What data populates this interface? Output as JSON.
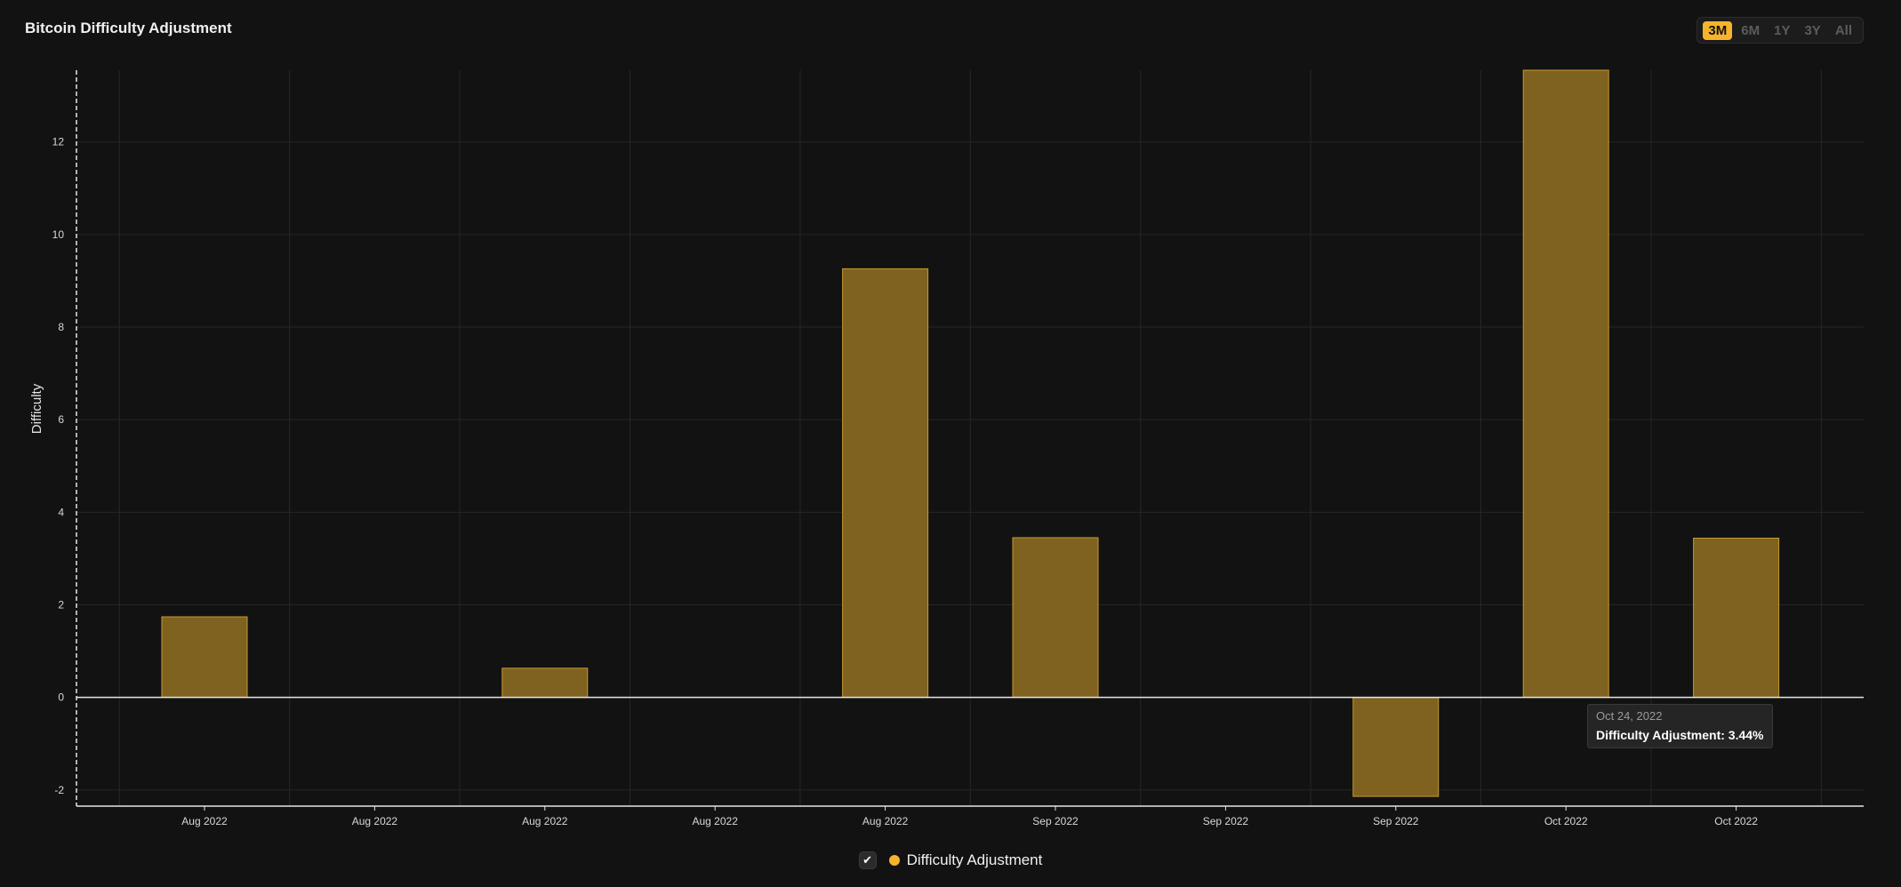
{
  "header": {
    "title": "Bitcoin Difficulty Adjustment"
  },
  "range_selector": {
    "options": [
      "3M",
      "6M",
      "1Y",
      "3Y",
      "All"
    ],
    "selected": "3M"
  },
  "legend": {
    "check_glyph": "✔",
    "label": "Difficulty Adjustment",
    "color": "#f7b32b"
  },
  "tooltip": {
    "date": "Oct 24, 2022",
    "text": "Difficulty Adjustment: 3.44%"
  },
  "chart_data": {
    "type": "bar",
    "ylabel": "Difficulty",
    "xlabel": "",
    "categories": [
      "Aug 2022",
      "Aug 2022",
      "Aug 2022",
      "Aug 2022",
      "Aug 2022",
      "Sep 2022",
      "Sep 2022",
      "Sep 2022",
      "Oct 2022",
      "Oct 2022"
    ],
    "series": [
      {
        "name": "Difficulty Adjustment",
        "values": [
          1.74,
          0,
          0.63,
          0,
          9.26,
          3.45,
          0,
          -2.14,
          13.55,
          3.44
        ]
      }
    ],
    "yticks": [
      -2,
      0,
      2,
      4,
      6,
      8,
      10,
      12
    ],
    "ylim": [
      -2.35,
      13.55
    ],
    "grid": true,
    "colors": {
      "bar_fill": "#7f6120",
      "bar_stroke": "#c59a2e",
      "grid": "#262626",
      "axis": "#e6e6e6"
    }
  }
}
